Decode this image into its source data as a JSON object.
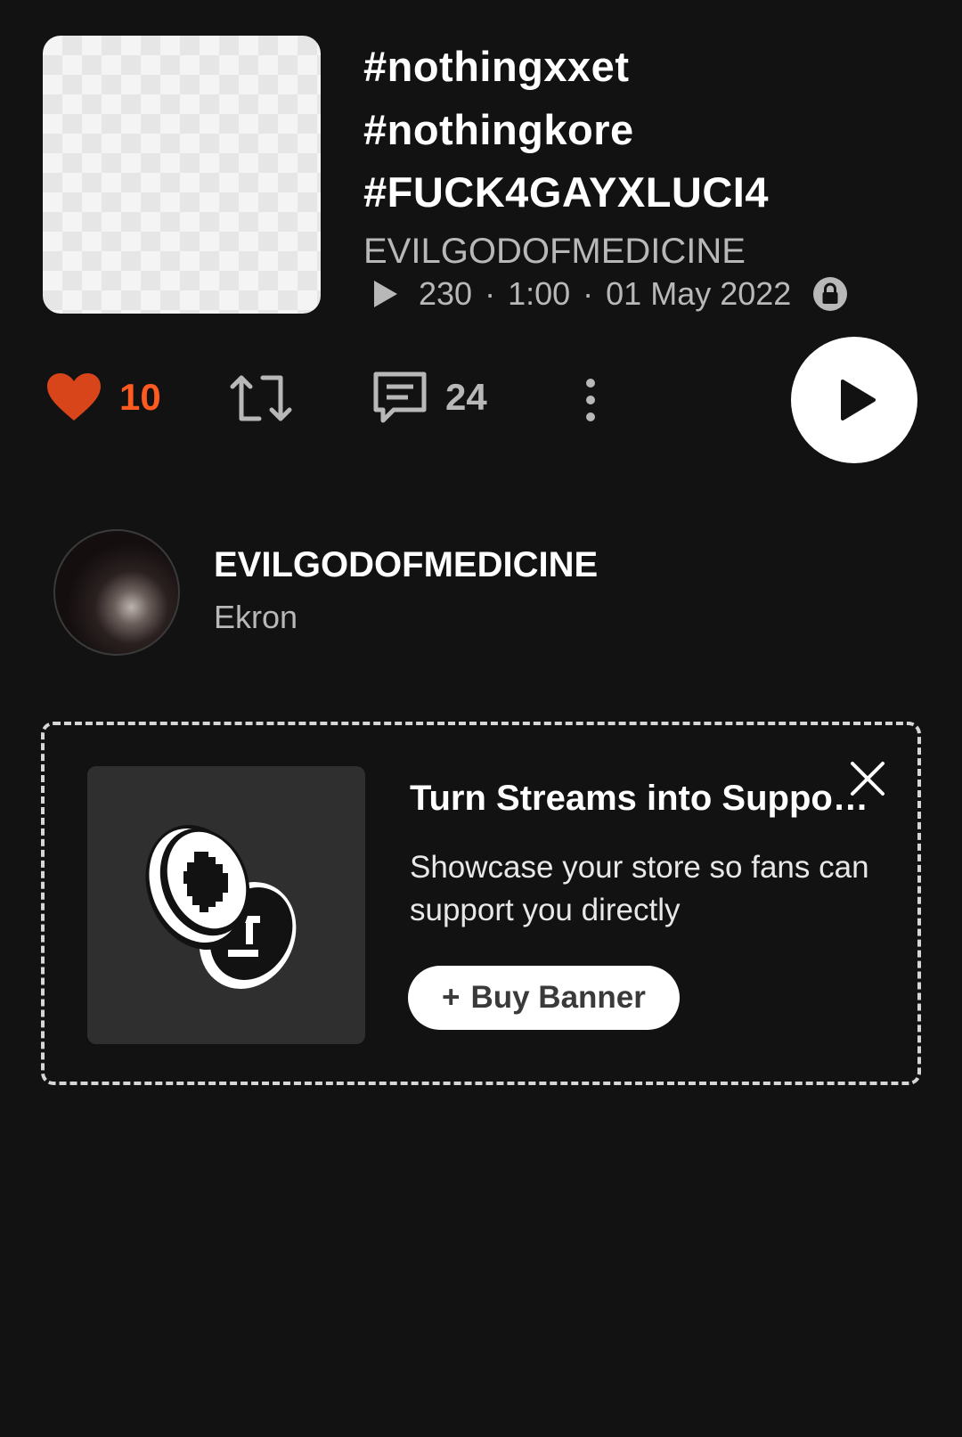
{
  "track": {
    "title_lines": [
      "#nothingxxet",
      "#nothingkore",
      "#FUCK4GAYXLUCI4"
    ],
    "artist": "EVILGODOFMEDICINE",
    "plays": "230",
    "duration": "1:00",
    "date": "01 May 2022",
    "separator": "·",
    "private": true
  },
  "actions": {
    "likes": "10",
    "comments": "24",
    "liked": true,
    "like_color": "#ff5a1f"
  },
  "user": {
    "name": "EVILGODOFMEDICINE",
    "location": "Ekron"
  },
  "promo": {
    "title": "Turn Streams into Supporters",
    "description": "Showcase your store so fans can support you directly",
    "button_plus": "+",
    "button_label": "Buy Banner"
  },
  "icons": {
    "heart": "heart-icon",
    "repost": "repost-icon",
    "comment": "comment-icon",
    "more": "more-vertical-icon",
    "play": "play-icon",
    "lock": "lock-icon",
    "close": "close-icon",
    "coins": "coins-icon"
  },
  "colors": {
    "background": "#121212",
    "accent": "#ff5a1f",
    "secondary_text": "#b8b8b8"
  }
}
